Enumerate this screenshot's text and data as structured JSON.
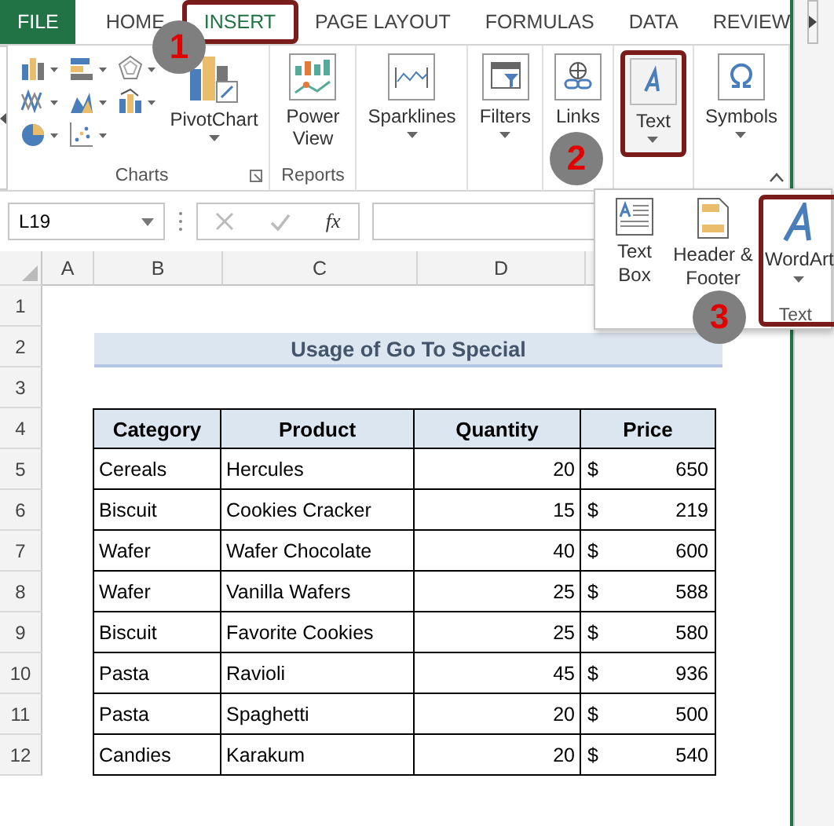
{
  "tabs": [
    {
      "label": "FILE",
      "kind": "file",
      "selected": false,
      "highlighted": false
    },
    {
      "label": "HOME",
      "kind": "tab",
      "selected": false,
      "highlighted": false
    },
    {
      "label": "INSERT",
      "kind": "tab",
      "selected": true,
      "highlighted": true
    },
    {
      "label": "PAGE LAYOUT",
      "kind": "tab",
      "selected": false,
      "highlighted": false
    },
    {
      "label": "FORMULAS",
      "kind": "tab",
      "selected": false,
      "highlighted": false
    },
    {
      "label": "DATA",
      "kind": "tab",
      "selected": false,
      "highlighted": false
    },
    {
      "label": "REVIEW",
      "kind": "tab",
      "selected": false,
      "highlighted": false
    }
  ],
  "ribbon_groups": [
    {
      "label": "Charts",
      "launcher": true,
      "buttons": [
        {
          "kind": "pivotchart",
          "label": "PivotChart",
          "dropdown": true,
          "highlighted": false
        }
      ]
    },
    {
      "label": "Reports",
      "buttons": [
        {
          "kind": "powerview",
          "label": "Power View",
          "highlighted": false
        }
      ]
    },
    {
      "buttons": [
        {
          "kind": "sparklines",
          "label": "Sparklines",
          "dropdown": true,
          "highlighted": false
        }
      ]
    },
    {
      "buttons": [
        {
          "kind": "filters",
          "label": "Filters",
          "dropdown": true,
          "highlighted": false
        }
      ]
    },
    {
      "buttons": [
        {
          "kind": "links",
          "label": "Links",
          "highlighted": false
        }
      ]
    },
    {
      "buttons": [
        {
          "kind": "text",
          "label": "Text",
          "dropdown": true,
          "highlighted": true
        }
      ]
    },
    {
      "buttons": [
        {
          "kind": "symbols",
          "label": "Symbols",
          "dropdown": true,
          "highlighted": false
        }
      ]
    }
  ],
  "text_popup": {
    "group_label": "Text",
    "items": [
      {
        "kind": "textbox",
        "label": "Text Box",
        "highlighted": false
      },
      {
        "kind": "headerfooter",
        "label": "Header & Footer",
        "highlighted": false
      },
      {
        "kind": "wordart",
        "label": "WordArt",
        "dropdown": true,
        "highlighted": true
      }
    ]
  },
  "formula_bar": {
    "name_box": "L19",
    "fx": "fx"
  },
  "columns": [
    "A",
    "B",
    "C",
    "D"
  ],
  "row_numbers": [
    "1",
    "2",
    "3",
    "4",
    "5",
    "6",
    "7",
    "8",
    "9",
    "10",
    "11",
    "12"
  ],
  "sheet": {
    "title": "Usage of Go To Special",
    "headers": [
      "Category",
      "Product",
      "Quantity",
      "Price"
    ],
    "rows": [
      {
        "category": "Cereals",
        "product": "Hercules",
        "quantity": "20",
        "currency": "$",
        "price": "650"
      },
      {
        "category": "Biscuit",
        "product": "Cookies Cracker",
        "quantity": "15",
        "currency": "$",
        "price": "219"
      },
      {
        "category": "Wafer",
        "product": "Wafer Chocolate",
        "quantity": "40",
        "currency": "$",
        "price": "600"
      },
      {
        "category": "Wafer",
        "product": "Vanilla Wafers",
        "quantity": "25",
        "currency": "$",
        "price": "588"
      },
      {
        "category": "Biscuit",
        "product": "Favorite Cookies",
        "quantity": "25",
        "currency": "$",
        "price": "580"
      },
      {
        "category": "Pasta",
        "product": "Ravioli",
        "quantity": "45",
        "currency": "$",
        "price": "936"
      },
      {
        "category": "Pasta",
        "product": "Spaghetti",
        "quantity": "20",
        "currency": "$",
        "price": "500"
      },
      {
        "category": "Candies",
        "product": "Karakum",
        "quantity": "20",
        "currency": "$",
        "price": "540"
      }
    ]
  },
  "callouts": [
    "1",
    "2",
    "3"
  ]
}
